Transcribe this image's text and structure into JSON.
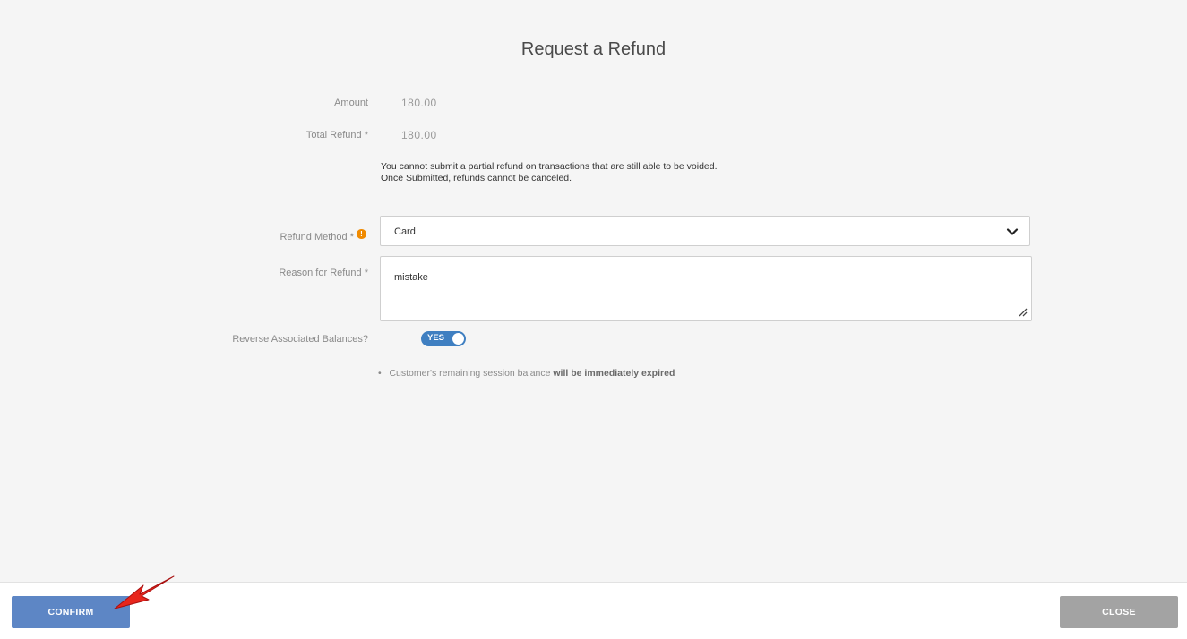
{
  "dialog": {
    "title": "Request a Refund"
  },
  "fields": {
    "amount": {
      "label": "Amount",
      "value": "180.00"
    },
    "total_refund": {
      "label": "Total Refund *",
      "value": "180.00"
    },
    "notice_line1": "You cannot submit a partial refund on transactions that are still able to be voided.",
    "notice_line2": "Once Submitted, refunds cannot be canceled.",
    "refund_method": {
      "label": "Refund Method *",
      "value": "Card",
      "info_icon": "info-icon",
      "info_glyph": "!"
    },
    "reason": {
      "label": "Reason for Refund *",
      "value": "mistake"
    },
    "reverse_balances": {
      "label": "Reverse Associated Balances?",
      "toggle_label": "YES",
      "state": true
    }
  },
  "bullet": {
    "marker": "•",
    "text": "Customer's remaining session balance",
    "emphasis": "will be immediately expired"
  },
  "footer": {
    "confirm_label": "CONFIRM",
    "close_label": "CLOSE"
  },
  "colors": {
    "confirm": "#5d86c5",
    "close": "#a3a3a3",
    "toggle": "#3f7fc1",
    "info": "#f08a00",
    "arrow": "#e8261c"
  }
}
